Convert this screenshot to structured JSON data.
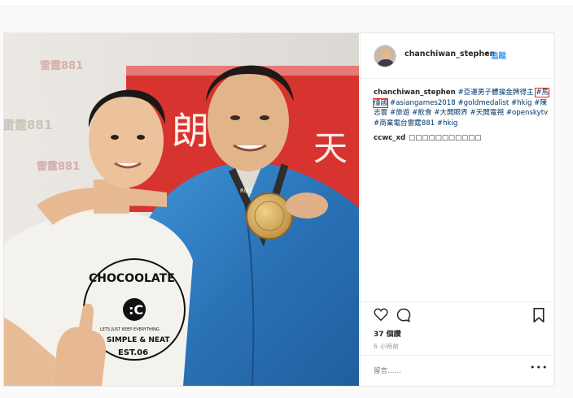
{
  "post": {
    "author": "chanchiwan_stephen",
    "separator": "•",
    "follow_label": "追蹤",
    "caption": {
      "author": "chanchiwan_stephen",
      "segments": [
        {
          "text": " "
        },
        {
          "text": "#亞運男子體操金牌得主",
          "tag": true
        },
        {
          "text": " "
        },
        {
          "text": "#馬僅國",
          "tag": true,
          "highlight": true
        },
        {
          "text": " "
        },
        {
          "text": "#asiangames2018",
          "tag": true
        },
        {
          "text": " "
        },
        {
          "text": "#goldmedalist",
          "tag": true
        },
        {
          "text": " "
        },
        {
          "text": "#hkig",
          "tag": true
        },
        {
          "text": " "
        },
        {
          "text": "#陳志雲",
          "tag": true
        },
        {
          "text": " "
        },
        {
          "text": "#旅遊",
          "tag": true
        },
        {
          "text": " "
        },
        {
          "text": "#飲食",
          "tag": true
        },
        {
          "text": " "
        },
        {
          "text": "#大開眼界",
          "tag": true
        },
        {
          "text": " "
        },
        {
          "text": "#天開電視",
          "tag": true
        },
        {
          "text": " "
        },
        {
          "text": "#openskytv",
          "tag": true
        },
        {
          "text": " "
        },
        {
          "text": "#商業電台雷霆881",
          "tag": true
        },
        {
          "text": " "
        },
        {
          "text": "#hkig",
          "tag": true
        }
      ]
    },
    "comments": [
      {
        "user": "ccwc_xd",
        "text": "□□□□□□□□□□□"
      }
    ],
    "likes": "37 個讚",
    "time_ago": "6 小時前",
    "comment_placeholder": "留言……",
    "more_label": "•••"
  },
  "photo": {
    "backdrop_text_1": "雷霆881",
    "backdrop_text_2": "雷霆881",
    "backdrop_text_3": "雷霆881",
    "banner_text": "朗",
    "banner_text_2": "天",
    "shirt_brand": "CHOCOOLATE",
    "shirt_line": "LETS JUST KEEP EVERYTHING",
    "shirt_line_2": "SIMPLE & NEAT",
    "shirt_line_3": "EST.06",
    "lanyard_text": "ROZ",
    "colors": {
      "backdrop": "#e9e6e2",
      "banner": "#d8342f",
      "jacket": "#2f7fc4",
      "shirt": "#f4f2ec",
      "medal": "#d2a85a"
    }
  },
  "icons": {
    "like": "heart-icon",
    "comment": "comment-bubble-icon",
    "save": "bookmark-icon",
    "more": "more-options-icon"
  }
}
